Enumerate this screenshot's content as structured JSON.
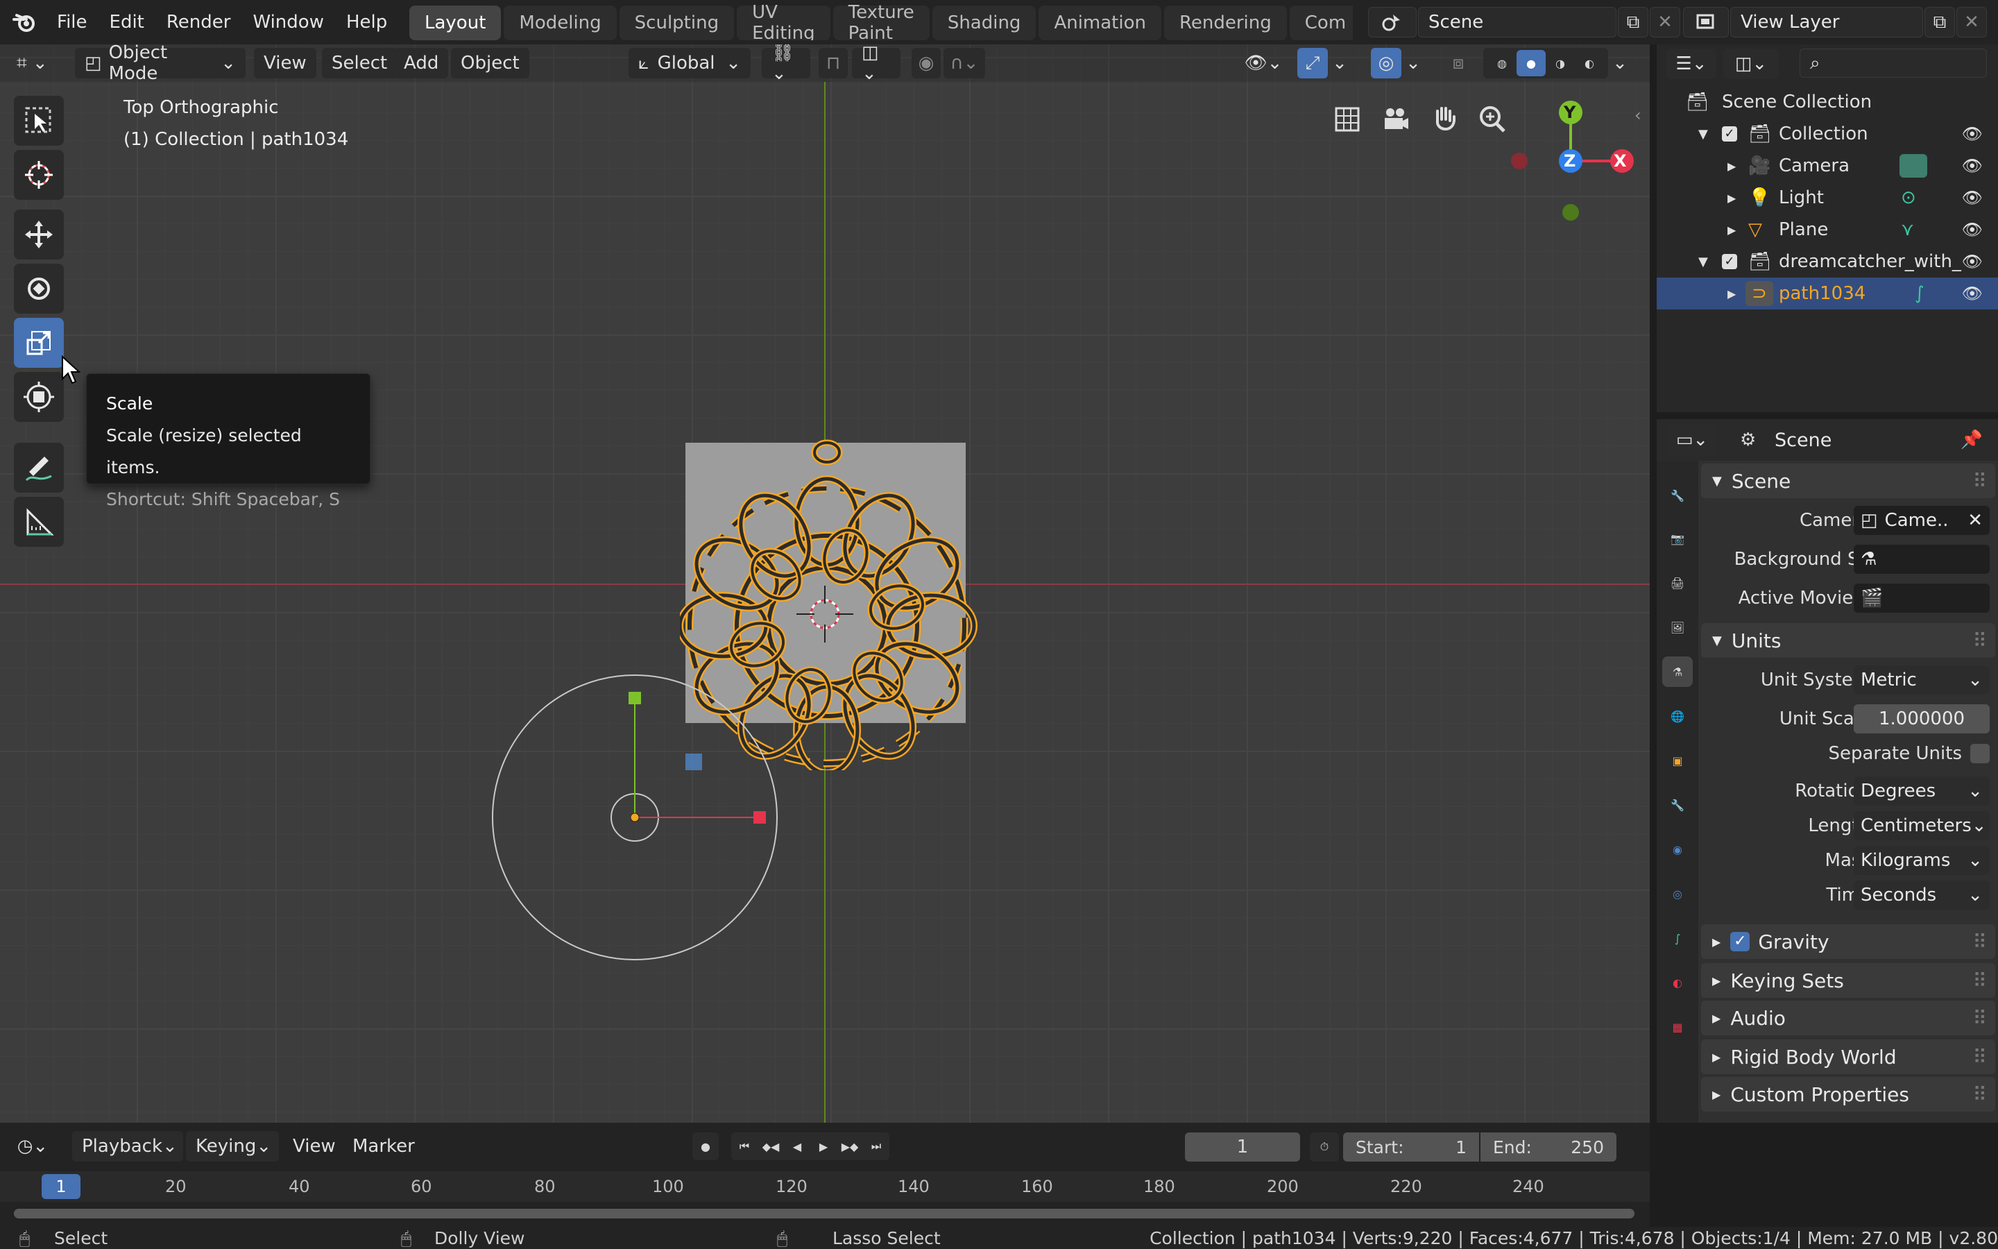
{
  "menus": [
    "File",
    "Edit",
    "Render",
    "Window",
    "Help"
  ],
  "workspaces": [
    "Layout",
    "Modeling",
    "Sculpting",
    "UV Editing",
    "Texture Paint",
    "Shading",
    "Animation",
    "Rendering",
    "Com"
  ],
  "active_workspace": "Layout",
  "scene_field": "Scene",
  "view_layer_field": "View Layer",
  "viewport": {
    "mode": "Object Mode",
    "menus": [
      "View",
      "Select",
      "Add",
      "Object"
    ],
    "orientation": "Global",
    "view_name": "Top Orthographic",
    "collection_info": "(1) Collection | path1034",
    "gizmo_axes": {
      "y": "Y",
      "z": "Z",
      "x": "X"
    }
  },
  "tooltip": {
    "title": "Scale",
    "description": "Scale (resize) selected items.",
    "shortcut": "Shortcut: Shift Spacebar, S"
  },
  "outliner": {
    "root": "Scene Collection",
    "items": [
      {
        "label": "Collection"
      },
      {
        "label": "Camera"
      },
      {
        "label": "Light"
      },
      {
        "label": "Plane"
      },
      {
        "label": "dreamcatcher_with_"
      },
      {
        "label": "path1034"
      }
    ]
  },
  "properties": {
    "header": "Scene",
    "scene_panel": "Scene",
    "camera_label": "Camera",
    "camera_value": "Came..",
    "background_label": "Background S..",
    "movie_label": "Active Movie ..",
    "units_panel": "Units",
    "unit_system_label": "Unit System",
    "unit_system_value": "Metric",
    "unit_scale_label": "Unit Scale",
    "unit_scale_value": "1.000000",
    "separate_units_label": "Separate Units",
    "rotation_label": "Rotation",
    "rotation_value": "Degrees",
    "length_label": "Length",
    "length_value": "Centimeters",
    "mass_label": "Mass",
    "mass_value": "Kilograms",
    "time_label": "Time",
    "time_value": "Seconds",
    "collapsed_panels": [
      "Gravity",
      "Keying Sets",
      "Audio",
      "Rigid Body World",
      "Custom Properties"
    ]
  },
  "timeline": {
    "menus": [
      "Playback",
      "Keying",
      "View",
      "Marker"
    ],
    "current_frame": "1",
    "start_label": "Start:",
    "start_value": "1",
    "end_label": "End:",
    "end_value": "250",
    "ruler": [
      "1",
      "20",
      "40",
      "60",
      "80",
      "100",
      "120",
      "140",
      "160",
      "180",
      "200",
      "220",
      "240"
    ]
  },
  "statusbar": {
    "select": "Select",
    "dolly": "Dolly View",
    "lasso": "Lasso Select",
    "stats": "Collection | path1034 | Verts:9,220 | Faces:4,677 | Tris:4,678 | Objects:1/4 | Mem: 27.0 MB | v2.80"
  },
  "colors": {
    "accent": "#4772b3",
    "selection": "#f5a623",
    "x_axis": "#e5344c",
    "y_axis": "#7ec22b",
    "z_axis": "#2f80ed"
  }
}
